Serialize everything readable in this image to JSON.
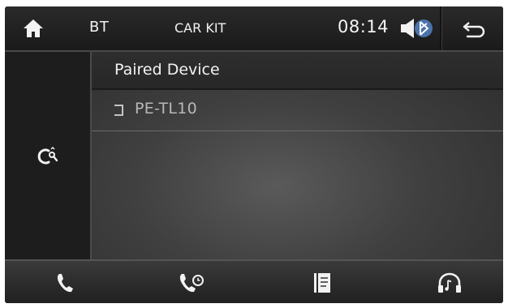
{
  "topbar": {
    "bt_label": "BT",
    "carkit_label": "CAR KIT",
    "clock": "08:14",
    "icons": [
      "home-icon",
      "volume-icon",
      "back-arrow-icon"
    ]
  },
  "side": {
    "icons": [
      "device-search-icon"
    ]
  },
  "main": {
    "header": "Paired Device",
    "devices": [
      {
        "name": "PE-TL10",
        "icon": "phone-icon"
      }
    ]
  },
  "bottombar": {
    "icons": [
      "dial-icon",
      "call-log-icon",
      "phonebook-icon",
      "music-icon"
    ]
  },
  "colors": {
    "background": "#202020",
    "text": "#f2f2f2",
    "device_text": "#b8b8b8"
  }
}
